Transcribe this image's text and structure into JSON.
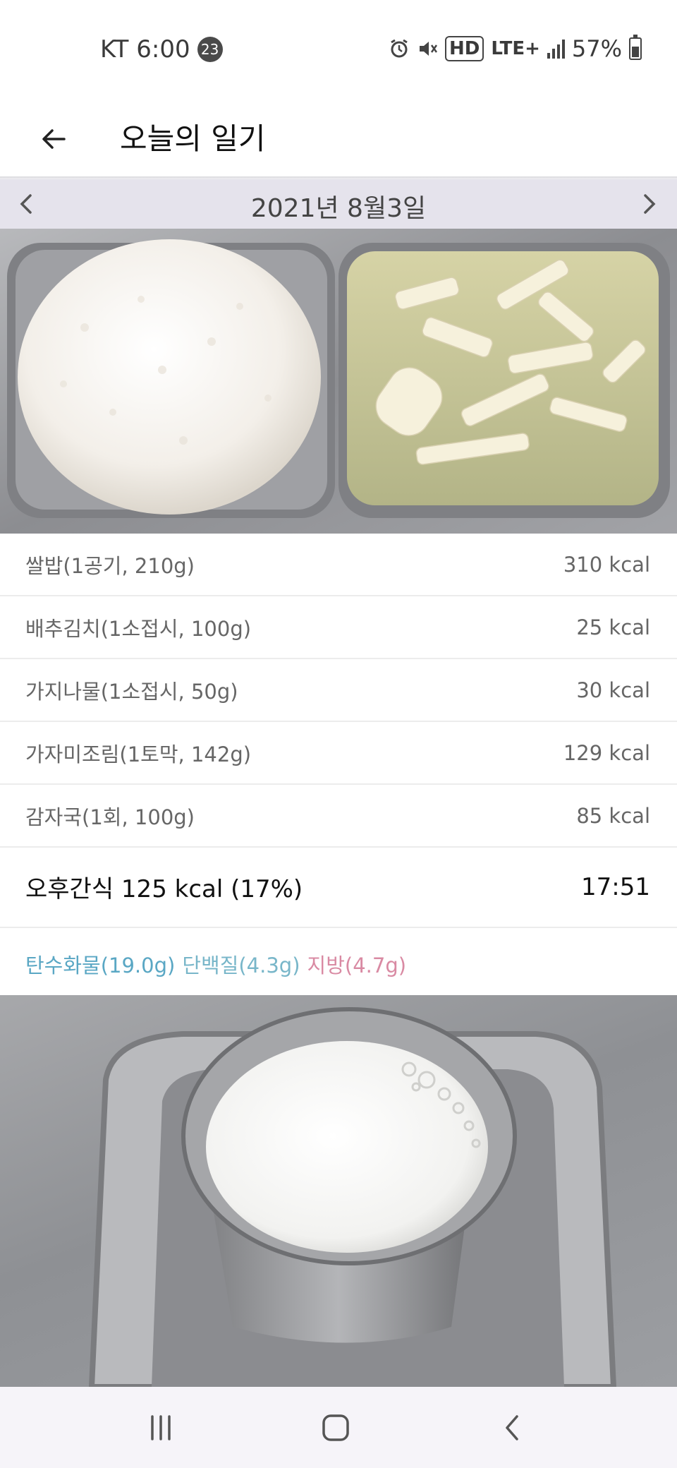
{
  "status_bar": {
    "carrier_time": "KT 6:00",
    "notification_count": "23",
    "lte_label": "LTE+",
    "hd_label": "HD",
    "battery": "57%",
    "icons": [
      "alarm-icon",
      "mute-icon",
      "hd-icon",
      "lte-icon",
      "signal-icon",
      "battery-icon"
    ]
  },
  "header": {
    "title": "오늘의 일기",
    "back_icon": "arrow-left-icon"
  },
  "date_nav": {
    "date": "2021년 8월3일",
    "prev_icon": "chevron-left-icon",
    "next_icon": "chevron-right-icon"
  },
  "foods": [
    {
      "name": "쌀밥(1공기, 210g)",
      "kcal": "310 kcal"
    },
    {
      "name": "배추김치(1소접시, 100g)",
      "kcal": "25 kcal"
    },
    {
      "name": "가지나물(1소접시, 50g)",
      "kcal": "30 kcal"
    },
    {
      "name": "가자미조림(1토막, 142g)",
      "kcal": "129 kcal"
    },
    {
      "name": "감자국(1회, 100g)",
      "kcal": "85 kcal"
    }
  ],
  "snack": {
    "title": "오후간식 125 kcal (17%)",
    "time": "17:51",
    "carbs": "탄수화물(19.0g)",
    "protein": "단백질(4.3g)",
    "fat": "지방(4.7g)"
  },
  "colors": {
    "carbs": "#5aa7c4",
    "protein": "#78b6c9",
    "fat": "#d98aa3",
    "date_bar": "#e5e3ec"
  },
  "nav_bar": {
    "icons": [
      "recent-apps-icon",
      "home-icon",
      "back-icon"
    ]
  }
}
